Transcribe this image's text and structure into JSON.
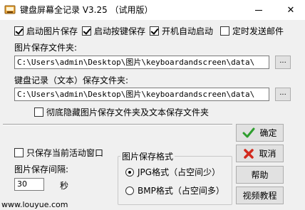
{
  "window": {
    "title": "键盘屏幕全记录 V3.25 （试用版）",
    "minimize_glyph": "",
    "close_glyph": "✕"
  },
  "options": {
    "save_images": {
      "label": "启动图片保存",
      "checked": true
    },
    "save_keys": {
      "label": "启动按键保存",
      "checked": true
    },
    "autostart": {
      "label": "开机自动启动",
      "checked": true
    },
    "timed_email": {
      "label": "定时发送邮件",
      "checked": false
    }
  },
  "image_folder": {
    "label": "图片保存文件夹:",
    "value": "C:\\Users\\admin\\Desktop\\图片\\keyboardandscreen\\data\\",
    "browse_label": "..."
  },
  "keylog_folder": {
    "label": "键盘记录（文本）保存文件夹:",
    "value": "C:\\Users\\admin\\Desktop\\图片\\keyboardandscreen\\data\\",
    "browse_label": "..."
  },
  "hide_folders": {
    "label": "彻底隐藏图片保存文件夹及文本保存文件夹",
    "checked": false
  },
  "active_window_only": {
    "label": "只保存当前活动窗口",
    "checked": false
  },
  "interval": {
    "label": "图片保存间隔:",
    "value": "30",
    "unit": "秒"
  },
  "format_group": {
    "title": "图片保存格式",
    "options": [
      {
        "label": "JPG格式（占空间少）",
        "selected": true
      },
      {
        "label": "BMP格式（占空间多）",
        "selected": false
      }
    ]
  },
  "buttons": {
    "ok": "确定",
    "cancel": "取消",
    "help": "帮助",
    "video": "视频教程"
  },
  "footer": {
    "url": "www.louyue.com"
  },
  "colors": {
    "ok_check": "#2e9e2e",
    "cancel_x": "#d22a1e"
  }
}
